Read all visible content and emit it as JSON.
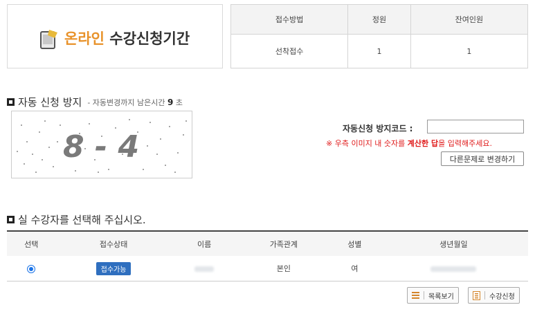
{
  "banner": {
    "title_accent": "온라인",
    "title_rest": "수강신청기간"
  },
  "info_table": {
    "headers": [
      "접수방법",
      "정원",
      "잔여인원"
    ],
    "row": [
      "선착접수",
      "1",
      "1"
    ]
  },
  "auto_block": {
    "title": "자동 신청 방지",
    "subtitle_prefix": "- 자동변경까지 남은시간",
    "seconds": "9",
    "subtitle_suffix": "초",
    "captcha_text": "8 - 4",
    "code_label": "자동신청 방지코드 :",
    "code_value": "",
    "notice_prefix": "※ 우측 이미지 내 숫자를",
    "notice_bold": "계산한 답",
    "notice_suffix": "을 입력해주세요.",
    "change_button": "다른문제로 변경하기"
  },
  "student_section": {
    "title": "실 수강자를 선택해 주십시오.",
    "headers": [
      "선택",
      "접수상태",
      "이름",
      "가족관계",
      "성별",
      "생년월일"
    ],
    "row": {
      "status": "접수가능",
      "relation": "본인",
      "gender": "여"
    }
  },
  "buttons": {
    "list": "목록보기",
    "apply": "수강신청"
  },
  "colors": {
    "accent": "#e8922a",
    "notice": "#e01b1b",
    "badge": "#2f6fbf",
    "radio": "#1a73e8"
  }
}
